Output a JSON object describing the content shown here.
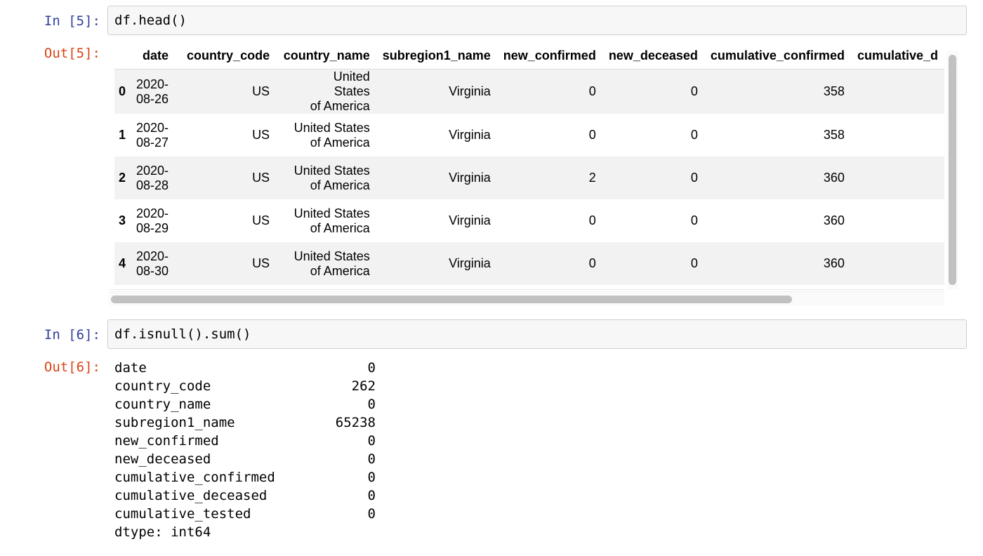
{
  "cells": [
    {
      "in_prompt": "In [5]:",
      "code": "df.head()",
      "out_prompt": "Out[5]:"
    },
    {
      "in_prompt": "In [6]:",
      "code": "df.isnull().sum()",
      "out_prompt": "Out[6]:"
    }
  ],
  "dataframe": {
    "columns": [
      "date",
      "country_code",
      "country_name",
      "subregion1_name",
      "new_confirmed",
      "new_deceased",
      "cumulative_confirmed",
      "cumulative_d"
    ],
    "rows": [
      {
        "index": "0",
        "date_a": "2020-",
        "date_b": "08-26",
        "country_code": "US",
        "cn_a": "United States",
        "cn_b": "of America",
        "subregion1_name": "Virginia",
        "new_confirmed": "0",
        "new_deceased": "0",
        "cumulative_confirmed": "358"
      },
      {
        "index": "1",
        "date_a": "2020-",
        "date_b": "08-27",
        "country_code": "US",
        "cn_a": "United States",
        "cn_b": "of America",
        "subregion1_name": "Virginia",
        "new_confirmed": "0",
        "new_deceased": "0",
        "cumulative_confirmed": "358"
      },
      {
        "index": "2",
        "date_a": "2020-",
        "date_b": "08-28",
        "country_code": "US",
        "cn_a": "United States",
        "cn_b": "of America",
        "subregion1_name": "Virginia",
        "new_confirmed": "2",
        "new_deceased": "0",
        "cumulative_confirmed": "360"
      },
      {
        "index": "3",
        "date_a": "2020-",
        "date_b": "08-29",
        "country_code": "US",
        "cn_a": "United States",
        "cn_b": "of America",
        "subregion1_name": "Virginia",
        "new_confirmed": "0",
        "new_deceased": "0",
        "cumulative_confirmed": "360"
      },
      {
        "index": "4",
        "date_a": "2020-",
        "date_b": "08-30",
        "country_code": "US",
        "cn_a": "United States",
        "cn_b": "of America",
        "subregion1_name": "Virginia",
        "new_confirmed": "0",
        "new_deceased": "0",
        "cumulative_confirmed": "360"
      }
    ]
  },
  "isnull": {
    "items": [
      {
        "name": "date",
        "value": "0"
      },
      {
        "name": "country_code",
        "value": "262"
      },
      {
        "name": "country_name",
        "value": "0"
      },
      {
        "name": "subregion1_name",
        "value": "65238"
      },
      {
        "name": "new_confirmed",
        "value": "0"
      },
      {
        "name": "new_deceased",
        "value": "0"
      },
      {
        "name": "cumulative_confirmed",
        "value": "0"
      },
      {
        "name": "cumulative_deceased",
        "value": "0"
      },
      {
        "name": "cumulative_tested",
        "value": "0"
      }
    ],
    "dtype": "dtype: int64"
  },
  "colors": {
    "in_prompt": "#303f9f",
    "out_prompt": "#d84315",
    "input_bg": "#f7f7f7",
    "row_stripe": "#f2f2f2"
  }
}
